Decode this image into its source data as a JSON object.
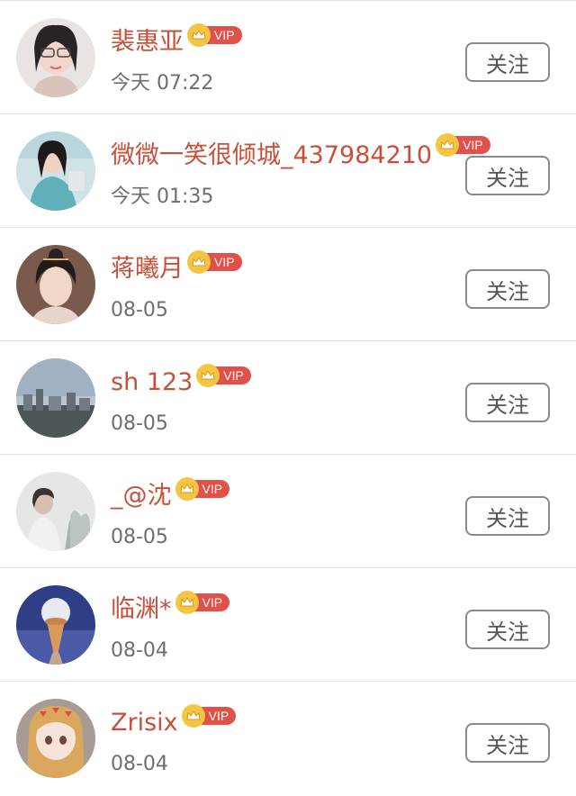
{
  "follow_label": "关注",
  "vip_label": "VIP",
  "users": [
    {
      "name": "裴惠亚",
      "time": "今天 07:22",
      "vip": true
    },
    {
      "name": "微微一笑很倾城_437984210",
      "time": "今天 01:35",
      "vip": true
    },
    {
      "name": "蒋曦月",
      "time": "08-05",
      "vip": true
    },
    {
      "name": "sh 123",
      "time": "08-05",
      "vip": true
    },
    {
      "name": "_@沈",
      "time": "08-05",
      "vip": true
    },
    {
      "name": "临渊*",
      "time": "08-04",
      "vip": true
    },
    {
      "name": "Zrisix",
      "time": "08-04",
      "vip": true
    }
  ],
  "colors": {
    "name": "#c8503a",
    "time": "#6e6e6e",
    "vip_badge": "#e0514a",
    "vip_crown": "#f4c542",
    "divider": "#e3e3e3"
  }
}
